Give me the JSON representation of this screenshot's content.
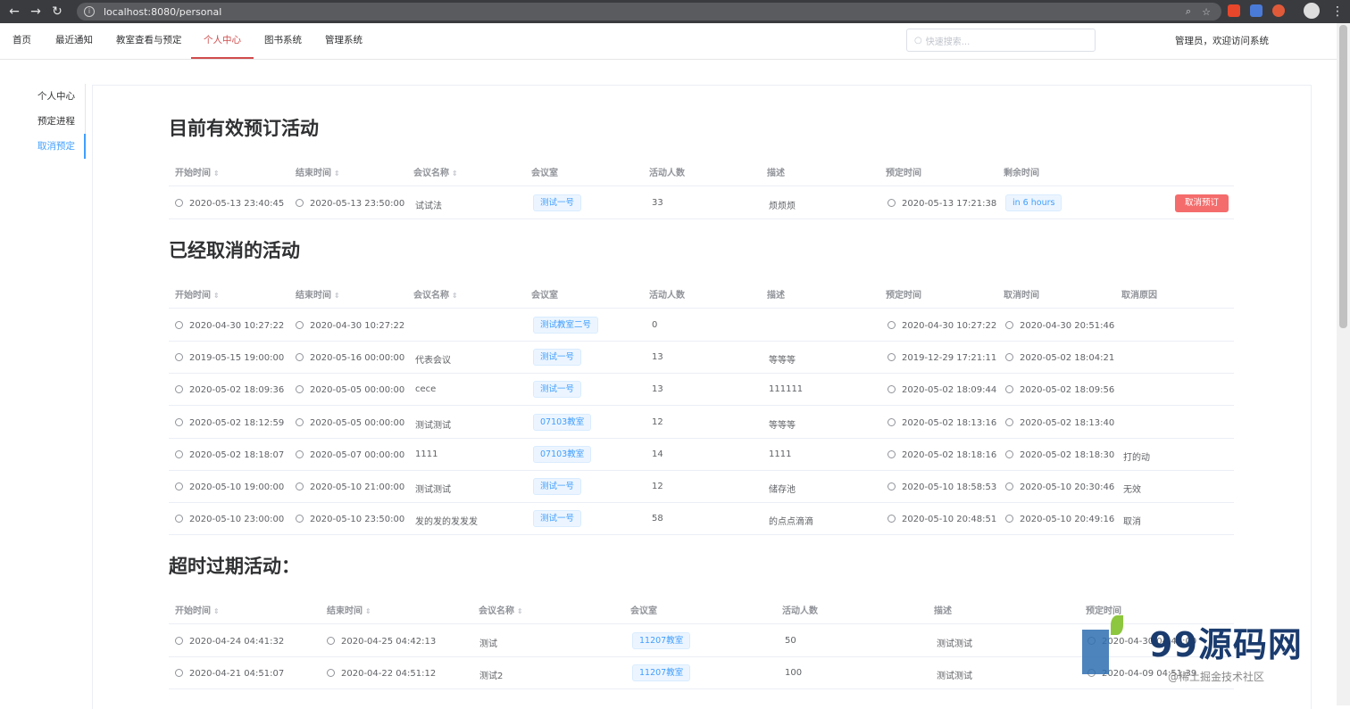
{
  "browser": {
    "url": "localhost:8080/personal",
    "back": "←",
    "forward": "→",
    "reload": "↻",
    "zoom_icon": "⌕",
    "star_icon": "☆"
  },
  "nav": {
    "items": [
      "首页",
      "最近通知",
      "教室查看与预定",
      "个人中心",
      "图书系统",
      "管理系统"
    ],
    "active_index": 3
  },
  "search": {
    "placeholder": "快速搜索..."
  },
  "welcome": "管理员，欢迎访问系统",
  "sidebar": {
    "items": [
      "个人中心",
      "预定进程",
      "取消预定"
    ],
    "active_index": 2
  },
  "section1": {
    "title": "目前有效预订活动",
    "headers": [
      "开始时间",
      "结束时间",
      "会议名称",
      "会议室",
      "活动人数",
      "描述",
      "预定时间",
      "剩余时间"
    ],
    "rows": [
      {
        "start": "2020-05-13 23:40:45",
        "end": "2020-05-13 23:50:00",
        "name": "试试法",
        "room": "测试一号",
        "people": "33",
        "desc": "烦烦烦",
        "booked": "2020-05-13 17:21:38",
        "remain": "in 6 hours",
        "action": "取消预订"
      }
    ]
  },
  "section2": {
    "title": "已经取消的活动",
    "headers": [
      "开始时间",
      "结束时间",
      "会议名称",
      "会议室",
      "活动人数",
      "描述",
      "预定时间",
      "取消时间",
      "取消原因"
    ],
    "rows": [
      {
        "start": "2020-04-30 10:27:22",
        "end": "2020-04-30 10:27:22",
        "name": "",
        "room": "测试教室二号",
        "people": "0",
        "desc": "",
        "booked": "2020-04-30 10:27:22",
        "cancelled": "2020-04-30 20:51:46",
        "reason": ""
      },
      {
        "start": "2019-05-15 19:00:00",
        "end": "2020-05-16 00:00:00",
        "name": "代表会议",
        "room": "测试一号",
        "people": "13",
        "desc": "等等等",
        "booked": "2019-12-29 17:21:11",
        "cancelled": "2020-05-02 18:04:21",
        "reason": ""
      },
      {
        "start": "2020-05-02 18:09:36",
        "end": "2020-05-05 00:00:00",
        "name": "cece",
        "room": "测试一号",
        "people": "13",
        "desc": "111111",
        "booked": "2020-05-02 18:09:44",
        "cancelled": "2020-05-02 18:09:56",
        "reason": ""
      },
      {
        "start": "2020-05-02 18:12:59",
        "end": "2020-05-05 00:00:00",
        "name": "测试测试",
        "room": "07103教室",
        "people": "12",
        "desc": "等等等",
        "booked": "2020-05-02 18:13:16",
        "cancelled": "2020-05-02 18:13:40",
        "reason": ""
      },
      {
        "start": "2020-05-02 18:18:07",
        "end": "2020-05-07 00:00:00",
        "name": "1111",
        "room": "07103教室",
        "people": "14",
        "desc": "1111",
        "booked": "2020-05-02 18:18:16",
        "cancelled": "2020-05-02 18:18:30",
        "reason": "打的动"
      },
      {
        "start": "2020-05-10 19:00:00",
        "end": "2020-05-10 21:00:00",
        "name": "测试测试",
        "room": "测试一号",
        "people": "12",
        "desc": "储存池",
        "booked": "2020-05-10 18:58:53",
        "cancelled": "2020-05-10 20:30:46",
        "reason": "无效"
      },
      {
        "start": "2020-05-10 23:00:00",
        "end": "2020-05-10 23:50:00",
        "name": "发的发的发发发",
        "room": "测试一号",
        "people": "58",
        "desc": "的点点滴滴",
        "booked": "2020-05-10 20:48:51",
        "cancelled": "2020-05-10 20:49:16",
        "reason": "取消"
      }
    ]
  },
  "section3": {
    "title": "超时过期活动：",
    "headers": [
      "开始时间",
      "结束时间",
      "会议名称",
      "会议室",
      "活动人数",
      "描述",
      "预定时间"
    ],
    "rows": [
      {
        "start": "2020-04-24 04:41:32",
        "end": "2020-04-25 04:42:13",
        "name": "测试",
        "room": "11207教室",
        "people": "50",
        "desc": "测试测试",
        "booked": "2020-04-30 04:44:00"
      },
      {
        "start": "2020-04-21 04:51:07",
        "end": "2020-04-22 04:51:12",
        "name": "测试2",
        "room": "11207教室",
        "people": "100",
        "desc": "测试测试",
        "booked": "2020-04-09 04:51:39"
      }
    ]
  },
  "watermark": {
    "brand": "99源码网",
    "sub": "@稀土掘金技术社区"
  },
  "colors": {
    "accent": "#409eff",
    "active_nav": "#d04b4b",
    "danger": "#f56c6c"
  }
}
